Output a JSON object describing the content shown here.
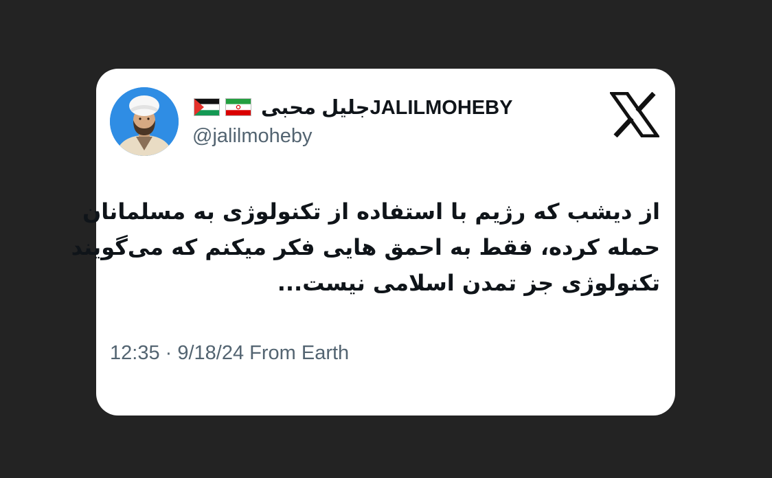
{
  "tweet": {
    "author": {
      "display_name": "جلیل محبیJALILMOHEBY",
      "handle": "@jalilmoheby",
      "flags": [
        "palestine-flag",
        "iran-flag"
      ],
      "avatar": "profile-photo"
    },
    "text_lines": [
      "از دیشب که رژیم با استفاده از تکنولوژی به مسلمانان",
      "حمله کرده، فقط به احمق هایی فکر میکنم که می‌گویند",
      "تکنولوژی جز تمدن اسلامی نیست..."
    ],
    "meta": "12:35 · 9/18/24 From Earth",
    "platform_icon": "x-logo-icon"
  },
  "colors": {
    "background": "#232323",
    "card": "#ffffff",
    "primary_text": "#0f1419",
    "secondary_text": "#536471",
    "avatar_bg": "#2f8de4"
  }
}
